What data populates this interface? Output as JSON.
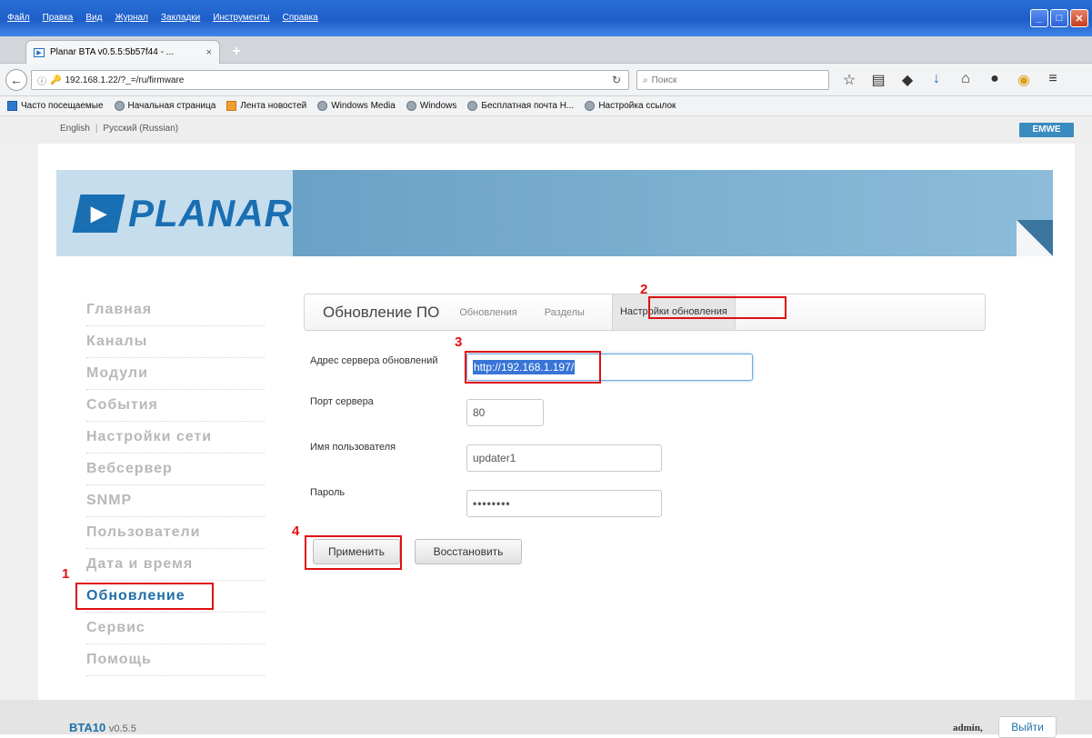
{
  "browser": {
    "menu": [
      "Файл",
      "Правка",
      "Вид",
      "Журнал",
      "Закладки",
      "Инструменты",
      "Справка"
    ],
    "tab_title": "Planar BTA v0.5.5:5b57f44 - ...",
    "url": "192.168.1.22/?_=/ru/firmware",
    "search_placeholder": "Поиск",
    "bookmarks": [
      "Часто посещаемые",
      "Начальная страница",
      "Лента новостей",
      "Windows Media",
      "Windows",
      "Бесплатная почта H...",
      "Настройка ссылок"
    ]
  },
  "page": {
    "lang_en": "English",
    "lang_ru": "Русский (Russian)",
    "vendor_logo": "EMWE",
    "logo_text": "PLANAR",
    "sidebar": [
      {
        "label": "Главная"
      },
      {
        "label": "Каналы"
      },
      {
        "label": "Модули"
      },
      {
        "label": "События"
      },
      {
        "label": "Настройки сети"
      },
      {
        "label": "Вебсервер"
      },
      {
        "label": "SNMP"
      },
      {
        "label": "Пользователи"
      },
      {
        "label": "Дата и время"
      },
      {
        "label": "Обновление"
      },
      {
        "label": "Сервис"
      },
      {
        "label": "Помощь"
      }
    ],
    "panel_title": "Обновление ПО",
    "tabs": [
      "Обновления",
      "Разделы",
      "Настройки обновления"
    ],
    "form": {
      "server_label": "Адрес сервера обновлений",
      "server_value": "http://192.168.1.197/",
      "port_label": "Порт сервера",
      "port_value": "80",
      "user_label": "Имя пользователя",
      "user_value": "updater1",
      "pass_label": "Пароль",
      "pass_value": "••••••••"
    },
    "apply_button": "Применить",
    "restore_button": "Восстановить",
    "annotations": [
      "1",
      "2",
      "3",
      "4"
    ],
    "footer_model": "BTA10",
    "footer_version": "v0.5.5",
    "footer_user": "admin,",
    "logout_button": "Выйти"
  }
}
